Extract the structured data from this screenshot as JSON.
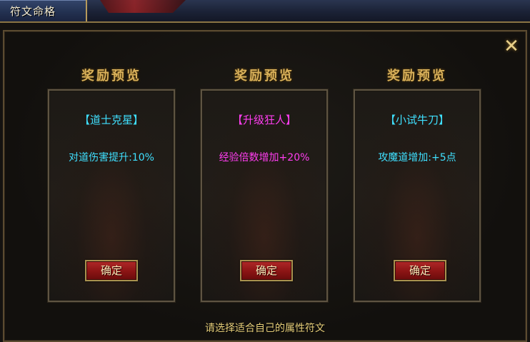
{
  "window": {
    "title": "符文命格"
  },
  "cards": [
    {
      "heading": "奖励预览",
      "name": "【道士克星】",
      "effect": "对道伤害提升:10%",
      "button": "确定",
      "color": "#3fe0ff"
    },
    {
      "heading": "奖励预览",
      "name": "【升级狂人】",
      "effect": "经验倍数增加+20%",
      "button": "确定",
      "color": "#ff3df0"
    },
    {
      "heading": "奖励预览",
      "name": "【小试牛刀】",
      "effect": "攻魔道增加:+5点",
      "button": "确定",
      "color": "#3fe0ff"
    }
  ],
  "footer": {
    "hint": "请选择适合自己的属性符文"
  },
  "icons": {
    "close": "close-icon"
  }
}
